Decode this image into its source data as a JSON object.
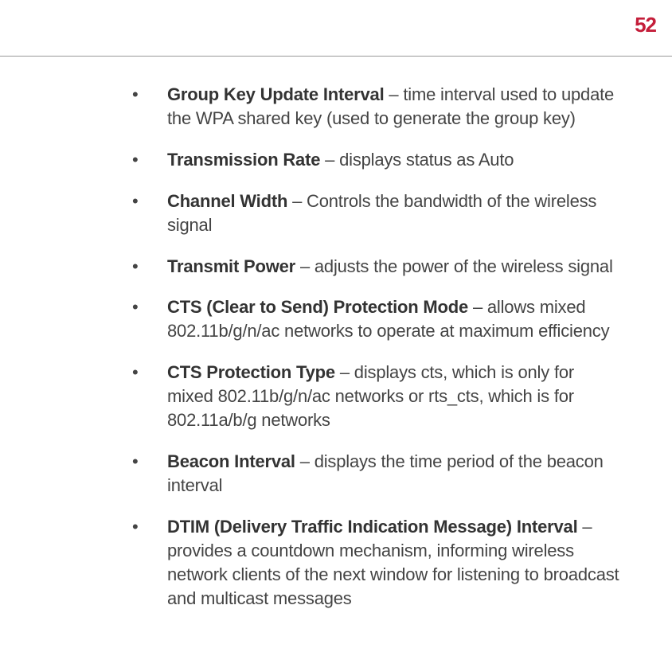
{
  "pageNumber": "52",
  "items": [
    {
      "term": "Group Key Update Interval",
      "desc": " – time interval used to update the WPA shared key (used to generate the group key)"
    },
    {
      "term": "Transmission Rate",
      "desc": " – displays status as Auto"
    },
    {
      "term": "Channel Width",
      "desc": " – Controls the bandwidth of the wireless signal"
    },
    {
      "term": "Transmit Power",
      "desc": " – adjusts the power of the wireless signal"
    },
    {
      "term": "CTS (Clear to Send) Protection Mode",
      "desc": " – allows mixed 802.11b/g/n/ac networks to operate at maximum efficiency"
    },
    {
      "term": "CTS Protection Type",
      "desc": " – displays cts, which is only for mixed 802.11b/g/n/ac networks or rts_cts, which is for 802.11a/b/g networks"
    },
    {
      "term": "Beacon Interval",
      "desc": " – displays the time period of the beacon interval"
    },
    {
      "term": "DTIM (Delivery Traffic Indication Message) Interval",
      "desc": " – provides a countdown mechanism, informing wireless network clients of the next window for listening to broadcast and multicast messages"
    }
  ]
}
